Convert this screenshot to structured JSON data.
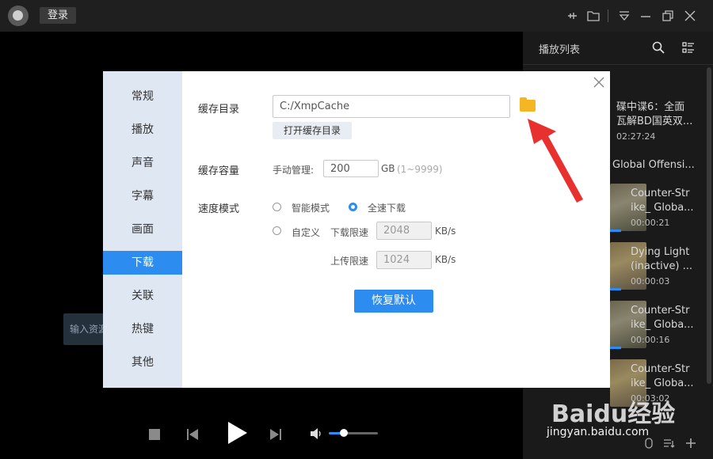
{
  "titlebar": {
    "login_label": "登录",
    "icons": [
      "pin-icon",
      "folder-icon",
      "menu-icon",
      "minimize-icon",
      "restore-icon",
      "close-icon"
    ]
  },
  "playlist": {
    "title": "播放列表",
    "items": [
      {
        "title_line1": "碟中谍6：全面",
        "title_line2": "瓦解BD国英双...",
        "duration": "02:27:24"
      },
      {
        "group_title": "Global Offensi..."
      },
      {
        "title_line1": "Counter-Str",
        "title_line2": "ike_ Globa...",
        "duration": "00:00:21"
      },
      {
        "title_line1": "Dying Light",
        "title_line2": "(inactive) ...",
        "duration": "00:00:03"
      },
      {
        "title_line1": "Counter-Str",
        "title_line2": "ike_ Globa...",
        "duration": "00:00:16"
      },
      {
        "title_line1": "Counter-Str",
        "title_line2": "ike_ Globa...",
        "duration": "00:03:02"
      }
    ]
  },
  "background_hint": "输入资源",
  "dialog": {
    "sidebar": [
      "常规",
      "播放",
      "声音",
      "字幕",
      "画面",
      "下载",
      "关联",
      "热键",
      "其他"
    ],
    "active_index": 5,
    "cache_dir_label": "缓存目录",
    "cache_dir_value": "C:/XmpCache",
    "open_cache_btn": "打开缓存目录",
    "cache_size_label": "缓存容量",
    "manual_label": "手动管理:",
    "cache_size_value": "200",
    "cache_size_unit": "GB",
    "cache_size_range": "(1~9999)",
    "speed_label": "速度模式",
    "smart_mode": "智能模式",
    "full_speed": "全速下载",
    "custom": "自定义",
    "download_limit_label": "下载限速",
    "download_limit_value": "2048",
    "upload_limit_label": "上传限速",
    "upload_limit_value": "1024",
    "speed_unit": "KB/s",
    "reset_btn": "恢复默认"
  },
  "player": {
    "volume": 0.3
  },
  "watermark": {
    "brand": "Baidu经验",
    "url": "jingyan.baidu.com"
  },
  "colors": {
    "accent": "#2d8cf0",
    "folder": "#f5b623",
    "arrow": "#e8312f"
  }
}
